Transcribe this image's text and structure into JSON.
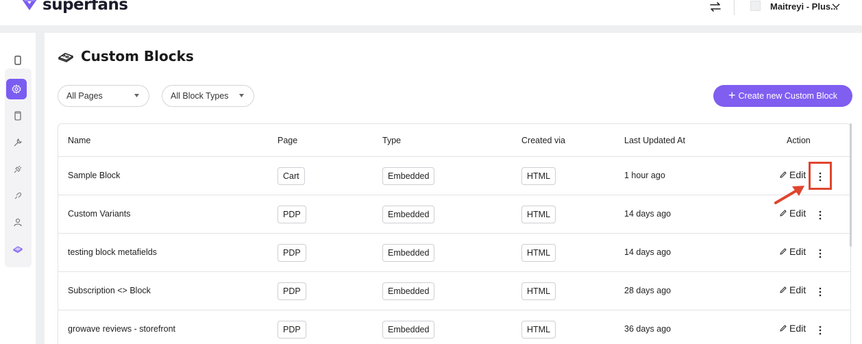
{
  "header": {
    "brand": "superfans",
    "user_name": "Maitreyi - Plus..."
  },
  "page": {
    "title": "Custom Blocks"
  },
  "filters": {
    "page_filter": "All Pages",
    "type_filter": "All Block Types"
  },
  "create_button": "Create new Custom Block",
  "table": {
    "columns": {
      "name": "Name",
      "page": "Page",
      "type": "Type",
      "created_via": "Created via",
      "last_updated": "Last Updated At",
      "action": "Action"
    },
    "edit_label": "Edit",
    "rows": [
      {
        "name": "Sample Block",
        "page": "Cart",
        "type": "Embedded",
        "created_via": "HTML",
        "updated": "1 hour ago"
      },
      {
        "name": "Custom Variants",
        "page": "PDP",
        "type": "Embedded",
        "created_via": "HTML",
        "updated": "14 days ago"
      },
      {
        "name": "testing block metafields",
        "page": "PDP",
        "type": "Embedded",
        "created_via": "HTML",
        "updated": "14 days ago"
      },
      {
        "name": "Subscription <> Block",
        "page": "PDP",
        "type": "Embedded",
        "created_via": "HTML",
        "updated": "28 days ago"
      },
      {
        "name": "growave reviews - storefront",
        "page": "PDP",
        "type": "Embedded",
        "created_via": "HTML",
        "updated": "36 days ago"
      }
    ]
  },
  "sidebar": {
    "items": [
      "mobile-icon",
      "settings-icon",
      "phone-icon",
      "wrench-icon",
      "plug-icon",
      "link-icon",
      "user-icon",
      "blocks-icon"
    ],
    "active": "settings-icon"
  },
  "colors": {
    "accent": "#7f5ef0",
    "annotation": "#e0452e",
    "band": "#eeeff1"
  }
}
